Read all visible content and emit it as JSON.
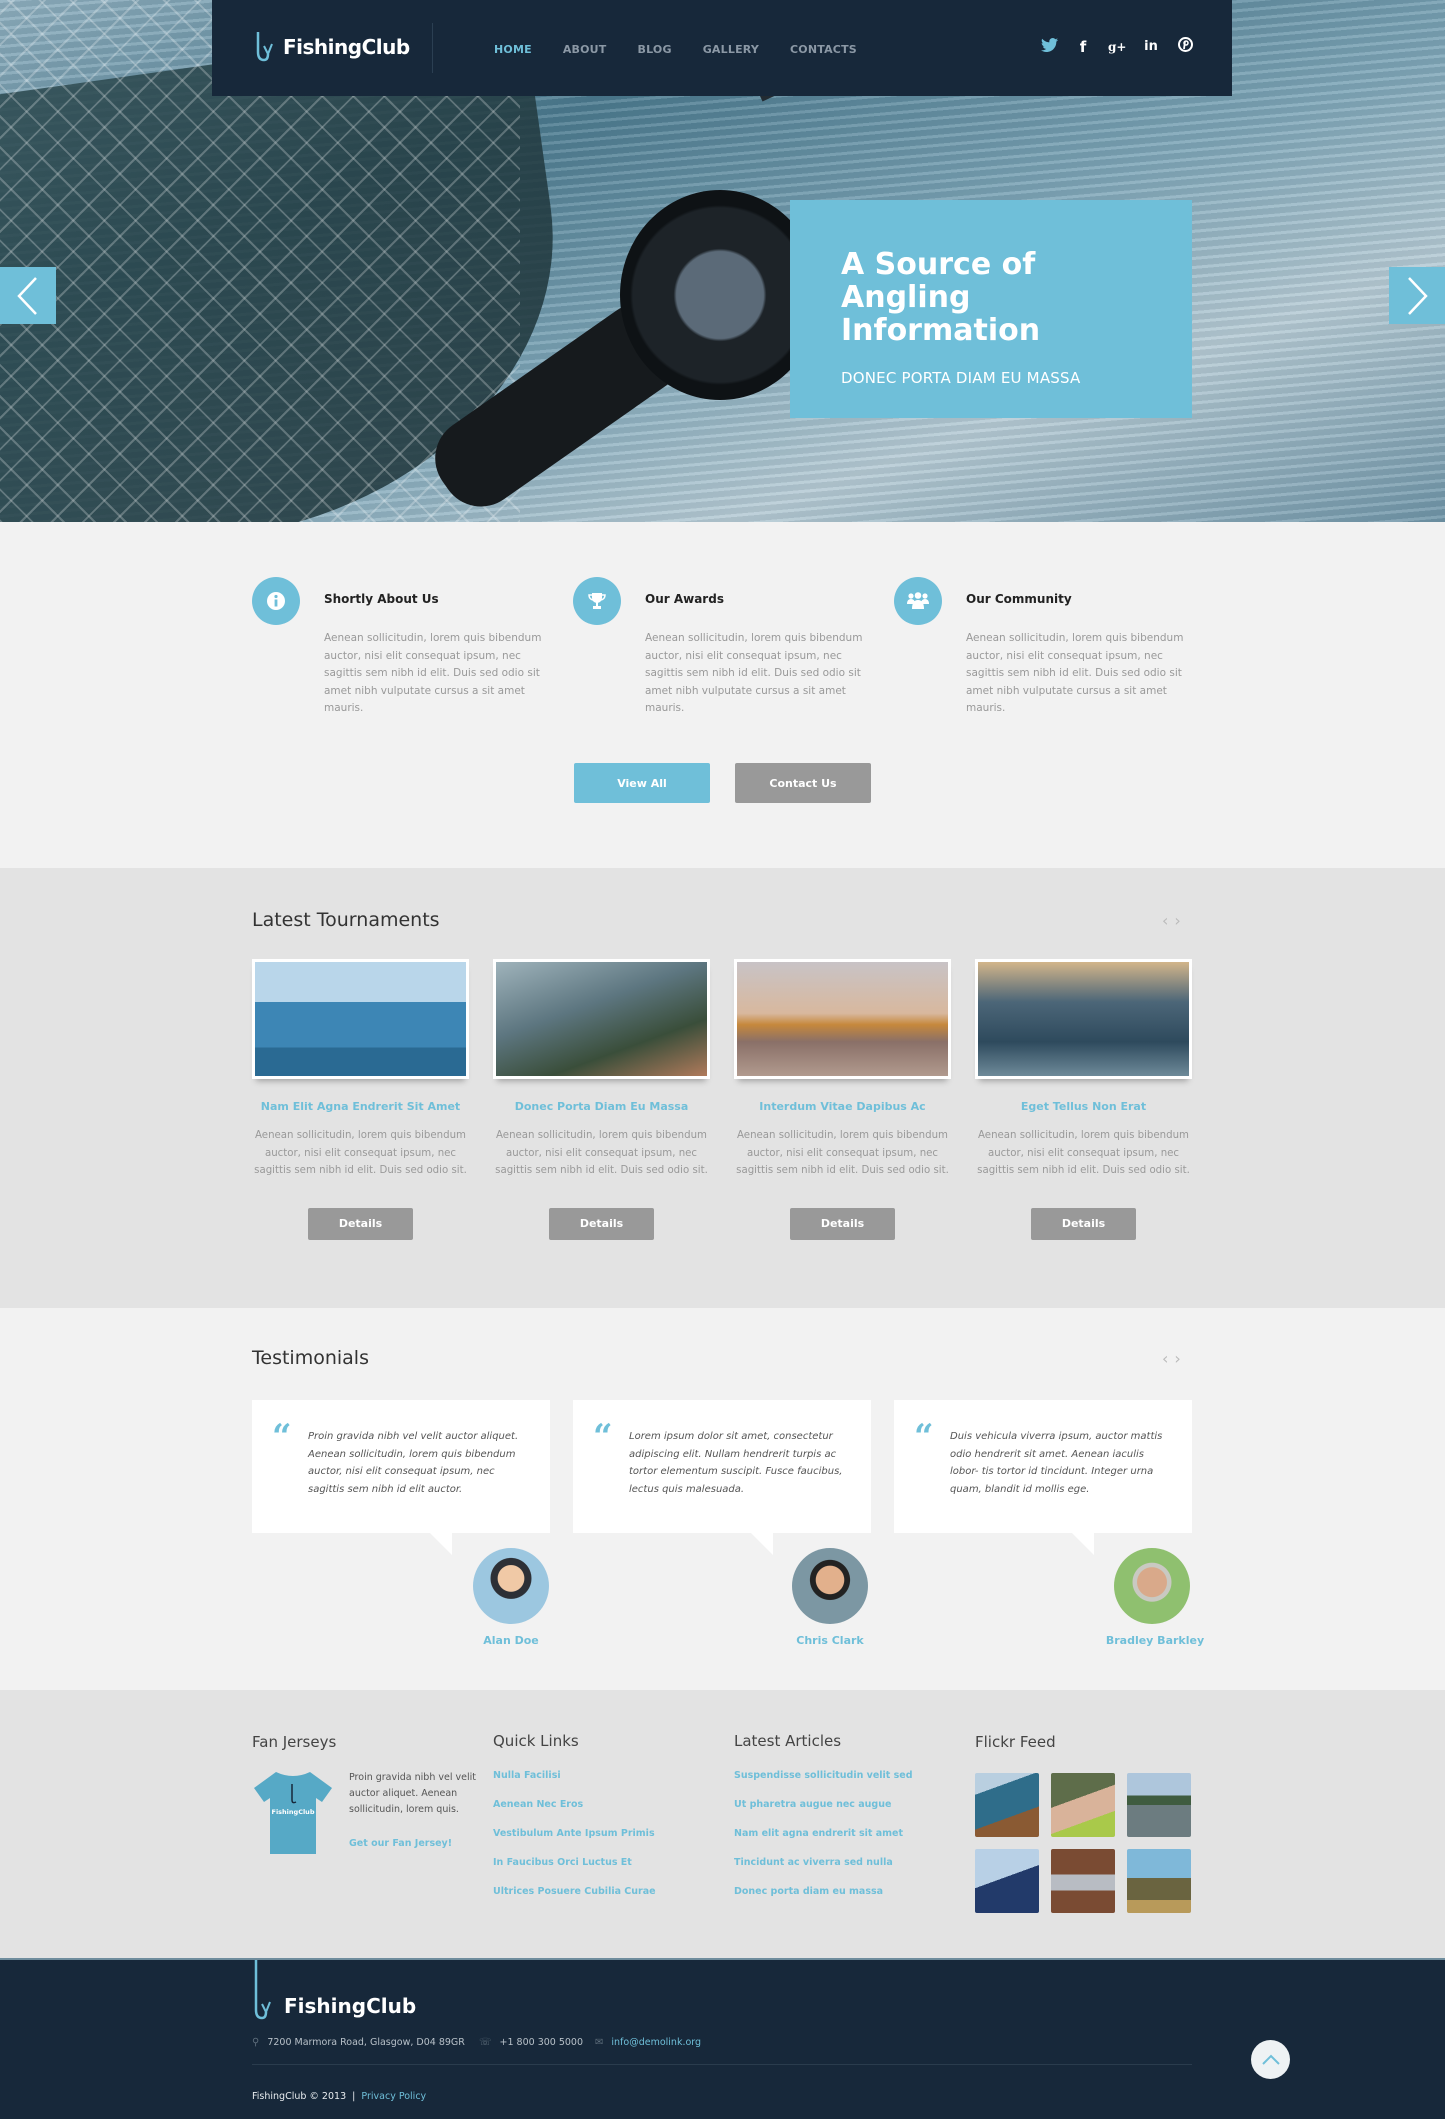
{
  "brand": {
    "name": "FishingClub",
    "accent": "#6fbfd9",
    "dark": "#17283a",
    "button_gray": "#999999"
  },
  "nav": {
    "items": [
      "HOME",
      "ABOUT",
      "BLOG",
      "GALLERY",
      "CONTACTS"
    ],
    "active": "HOME"
  },
  "social": [
    "twitter-icon",
    "facebook-icon",
    "google-plus-icon",
    "linkedin-icon",
    "pinterest-icon"
  ],
  "social_glyphs": {
    "twitter": "🐦",
    "facebook": "f",
    "google": "g+",
    "linkedin": "in",
    "pinterest": "℗"
  },
  "hero": {
    "title": "A Source of Angling Information",
    "subtitle": "DONEC PORTA DIAM EU MASSA",
    "prev_label": "previous slide",
    "next_label": "next slide"
  },
  "features": [
    {
      "icon": "info-icon",
      "title": "Shortly About Us",
      "text": "Aenean sollicitudin, lorem quis bibendum auctor, nisi elit consequat ipsum, nec sagittis sem nibh id elit. Duis sed odio sit amet nibh vulputate cursus a sit amet mauris."
    },
    {
      "icon": "trophy-icon",
      "title": "Our Awards",
      "text": "Aenean sollicitudin, lorem quis bibendum auctor, nisi elit consequat ipsum, nec sagittis sem nibh id elit. Duis sed odio sit amet nibh vulputate cursus a sit amet mauris."
    },
    {
      "icon": "community-icon",
      "title": "Our Community",
      "text": "Aenean sollicitudin, lorem quis bibendum auctor, nisi elit consequat ipsum, nec sagittis sem nibh id elit. Duis sed odio sit amet nibh vulputate cursus a sit amet mauris."
    }
  ],
  "buttons": {
    "view_all": "View All",
    "contact_us": "Contact Us"
  },
  "tournaments": {
    "title": "Latest Tournaments",
    "prev": "‹",
    "next": "›",
    "items": [
      {
        "title": "Nam Elit Agna Endrerit Sit Amet",
        "text": "Aenean sollicitudin, lorem quis bibendum auctor, nisi elit consequat ipsum, nec sagittis sem nibh id elit. Duis sed odio sit.",
        "button": "Details"
      },
      {
        "title": "Donec Porta Diam Eu Massa",
        "text": "Aenean sollicitudin, lorem quis bibendum auctor, nisi elit consequat ipsum, nec sagittis sem nibh id elit. Duis sed odio sit.",
        "button": "Details"
      },
      {
        "title": "Interdum Vitae Dapibus Ac",
        "text": "Aenean sollicitudin, lorem quis bibendum auctor, nisi elit consequat ipsum, nec sagittis sem nibh id elit. Duis sed odio sit.",
        "button": "Details"
      },
      {
        "title": "Eget Tellus Non Erat",
        "text": "Aenean sollicitudin, lorem quis bibendum auctor, nisi elit consequat ipsum, nec sagittis sem nibh id elit. Duis sed odio sit.",
        "button": "Details"
      }
    ]
  },
  "testimonials": {
    "title": "Testimonials",
    "prev": "‹",
    "next": "›",
    "quote_mark": "“",
    "items": [
      {
        "text": "Proin gravida nibh vel velit auctor aliquet. Aenean sollicitudin, lorem quis bibendum auctor, nisi elit consequat ipsum, nec sagittis sem nibh id elit auctor.",
        "name": "Alan Doe"
      },
      {
        "text": "Lorem ipsum dolor sit amet, consectetur adipiscing elit. Nullam hendrerit turpis ac tortor elementum suscipit. Fusce faucibus, lectus quis malesuada.",
        "name": "Chris Clark"
      },
      {
        "text": "Duis vehicula viverra ipsum, auctor mattis odio hendrerit sit amet. Aenean iaculis lobor- tis tortor id tincidunt. Integer urna quam, blandit id mollis ege.",
        "name": "Bradley Barkley"
      }
    ]
  },
  "widgets": {
    "fan_jerseys": {
      "title": "Fan Jerseys",
      "text": "Proin gravida nibh vel velit auctor aliquet. Aenean sollicitudin, lorem quis.",
      "link": "Get our Fan Jersey!",
      "shirt_label": "FishingClub"
    },
    "quick_links": {
      "title": "Quick Links",
      "items": [
        "Nulla Facilisi",
        "Aenean Nec Eros",
        "Vestibulum Ante Ipsum Primis",
        "In Faucibus Orci Luctus Et",
        "Ultrices Posuere Cubilia Curae"
      ]
    },
    "latest_articles": {
      "title": "Latest Articles",
      "items": [
        "Suspendisse sollicitudin velit sed",
        "Ut pharetra augue nec augue",
        "Nam elit agna endrerit sit amet",
        "Tincidunt ac viverra sed nulla",
        "Donec porta diam eu massa"
      ]
    },
    "flickr": {
      "title": "Flickr Feed",
      "count": 6
    }
  },
  "footer": {
    "address": "7200  Marmora Road, Glasgow, D04 89GR",
    "phone": "+1 800 300 5000",
    "email": "info@demolink.org",
    "copyright": "FishingClub © 2013",
    "separator": "|",
    "privacy": "Privacy Policy",
    "icons": {
      "pin": "⚲",
      "phone": "☏",
      "mail": "✉"
    }
  }
}
